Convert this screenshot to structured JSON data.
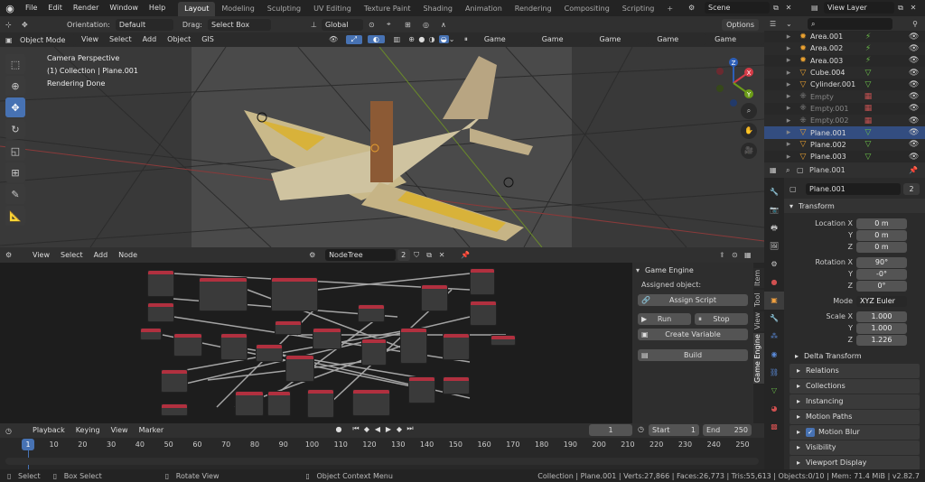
{
  "topbar": {
    "menus": [
      "File",
      "Edit",
      "Render",
      "Window",
      "Help"
    ],
    "workspaces": [
      "Layout",
      "Modeling",
      "Sculpting",
      "UV Editing",
      "Texture Paint",
      "Shading",
      "Animation",
      "Rendering",
      "Compositing",
      "Scripting"
    ],
    "active_workspace": "Layout",
    "add_tab": "+",
    "scene": "Scene",
    "view_layer": "View Layer"
  },
  "tool_header": {
    "orientation_label": "Orientation:",
    "orientation_value": "Default",
    "drag_label": "Drag:",
    "drag_value": "Select Box",
    "transform_orientation": "Global",
    "options": "Options"
  },
  "viewport": {
    "mode": "Object Mode",
    "menus": [
      "View",
      "Select",
      "Add",
      "Object",
      "GIS"
    ],
    "engine_tabs": [
      "Game Engine",
      "Game Engine",
      "Game Engine",
      "Game Engine",
      "Game Engine"
    ],
    "overlay_lines": [
      "Camera Perspective",
      "(1) Collection | Plane.001",
      "Rendering Done"
    ],
    "gizmo": {
      "x": "X",
      "y": "Y",
      "z": "Z"
    }
  },
  "outliner": {
    "items": [
      {
        "name": "Area.001",
        "type": "light"
      },
      {
        "name": "Area.002",
        "type": "light"
      },
      {
        "name": "Area.003",
        "type": "light"
      },
      {
        "name": "Cube.004",
        "type": "mesh"
      },
      {
        "name": "Cylinder.001",
        "type": "mesh"
      },
      {
        "name": "Empty",
        "type": "empty"
      },
      {
        "name": "Empty.001",
        "type": "empty"
      },
      {
        "name": "Empty.002",
        "type": "empty"
      },
      {
        "name": "Plane.001",
        "type": "mesh"
      },
      {
        "name": "Plane.002",
        "type": "mesh"
      },
      {
        "name": "Plane.003",
        "type": "mesh"
      }
    ]
  },
  "properties": {
    "header_object": "Plane.001",
    "object_name": "Plane.001",
    "object_users": "2",
    "transform_title": "Transform",
    "location": {
      "label": "Location X",
      "x": "0 m",
      "y": "0 m",
      "z": "0 m"
    },
    "rotation": {
      "label": "Rotation X",
      "x": "90°",
      "y": "-0°",
      "z": "0°"
    },
    "mode_label": "Mode",
    "mode_value": "XYZ Euler",
    "scale": {
      "label": "Scale X",
      "x": "1.000",
      "y": "1.000",
      "z": "1.226"
    },
    "axis_y": "Y",
    "axis_z": "Z",
    "delta_transform": "Delta Transform",
    "panels": [
      "Relations",
      "Collections",
      "Instancing",
      "Motion Paths",
      "Motion Blur",
      "Visibility",
      "Viewport Display"
    ],
    "motion_blur_checked": true
  },
  "node_editor": {
    "menus": [
      "View",
      "Select",
      "Add",
      "Node"
    ],
    "tree_name": "NodeTree",
    "tree_users": "2"
  },
  "game_engine_panel": {
    "title": "Game Engine",
    "assigned_label": "Assigned object:",
    "assign_script": "Assign Script",
    "run": "Run",
    "stop": "Stop",
    "create_variable": "Create Variable",
    "build": "Build",
    "side_tabs": [
      "Item",
      "Tool",
      "View",
      "Game Engine"
    ]
  },
  "timeline": {
    "menus": [
      "Playback",
      "Keying",
      "View",
      "Marker"
    ],
    "current_frame": "1",
    "start_label": "Start",
    "start": "1",
    "end_label": "End",
    "end": "250",
    "ticks": [
      "1",
      "10",
      "20",
      "30",
      "40",
      "50",
      "60",
      "70",
      "80",
      "90",
      "100",
      "110",
      "120",
      "130",
      "140",
      "150",
      "160",
      "170",
      "180",
      "190",
      "200",
      "210",
      "220",
      "230",
      "240",
      "250"
    ]
  },
  "statusbar": {
    "select": "Select",
    "box_select": "Box Select",
    "rotate_view": "Rotate View",
    "context_menu": "Object Context Menu",
    "stats": "Collection | Plane.001 | Verts:27,866 | Faces:26,773 | Tris:55,613 | Objects:0/10 | Mem: 71.4 MiB | v2.82.7"
  },
  "colors": {
    "accent": "#4772b3",
    "node_header": "#b1303f",
    "frame_marker": "#4772b3"
  }
}
